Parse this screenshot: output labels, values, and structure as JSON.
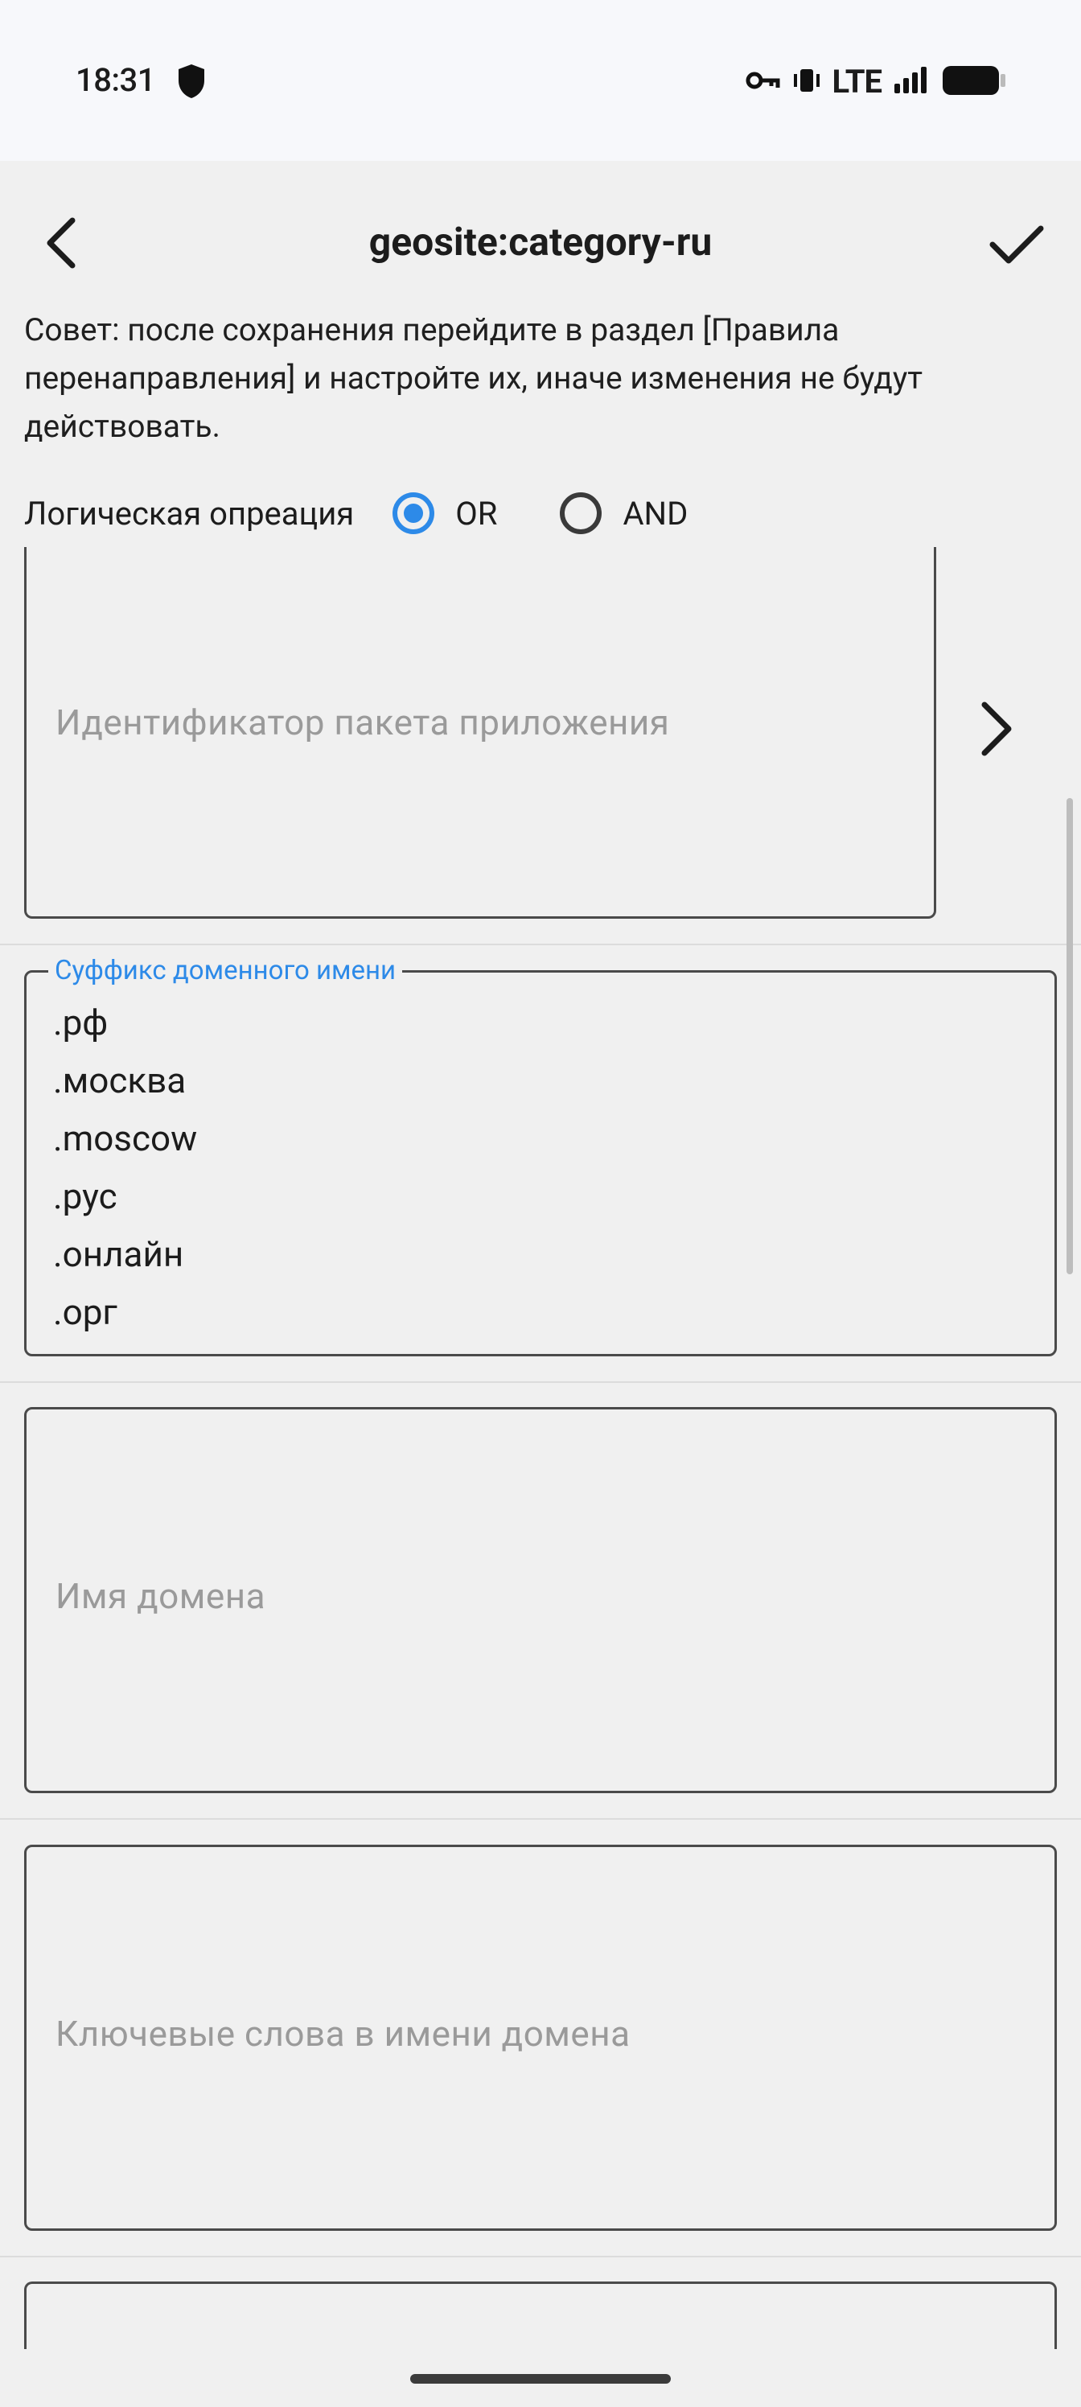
{
  "status": {
    "time": "18:31",
    "network": "LTE",
    "icons": [
      "shield-icon",
      "vpn-key-icon",
      "vibrate-icon",
      "signal-icon",
      "battery-icon"
    ]
  },
  "appbar": {
    "title": "geosite:category-ru",
    "back_icon": "back-arrow-icon",
    "save_icon": "checkmark-icon"
  },
  "tip": "Совет: после сохранения перейдите в раздел [Правила перенаправления] и настройте их, иначе изменения не будут действовать.",
  "logic": {
    "label": "Логическая опреацияя",
    "options": [
      {
        "label": "OR",
        "selected": true
      },
      {
        "label": "AND",
        "selected": false
      }
    ]
  },
  "fields": {
    "package_id": {
      "placeholder": "Идентификатор пакета приложения"
    },
    "domain_suffix": {
      "label": "Суффикс доменного имени",
      "values": [
        ".рф",
        ".москва",
        ".moscow",
        ".рус",
        ".онлайн",
        ".орг"
      ]
    },
    "domain_name": {
      "placeholder": "Имя домена"
    },
    "domain_keywords": {
      "placeholder": "Ключевые слова в имени домена"
    }
  },
  "colors": {
    "accent": "#2d8ae8",
    "background": "#f0f0f0",
    "statusbar": "#f7f8fb"
  }
}
